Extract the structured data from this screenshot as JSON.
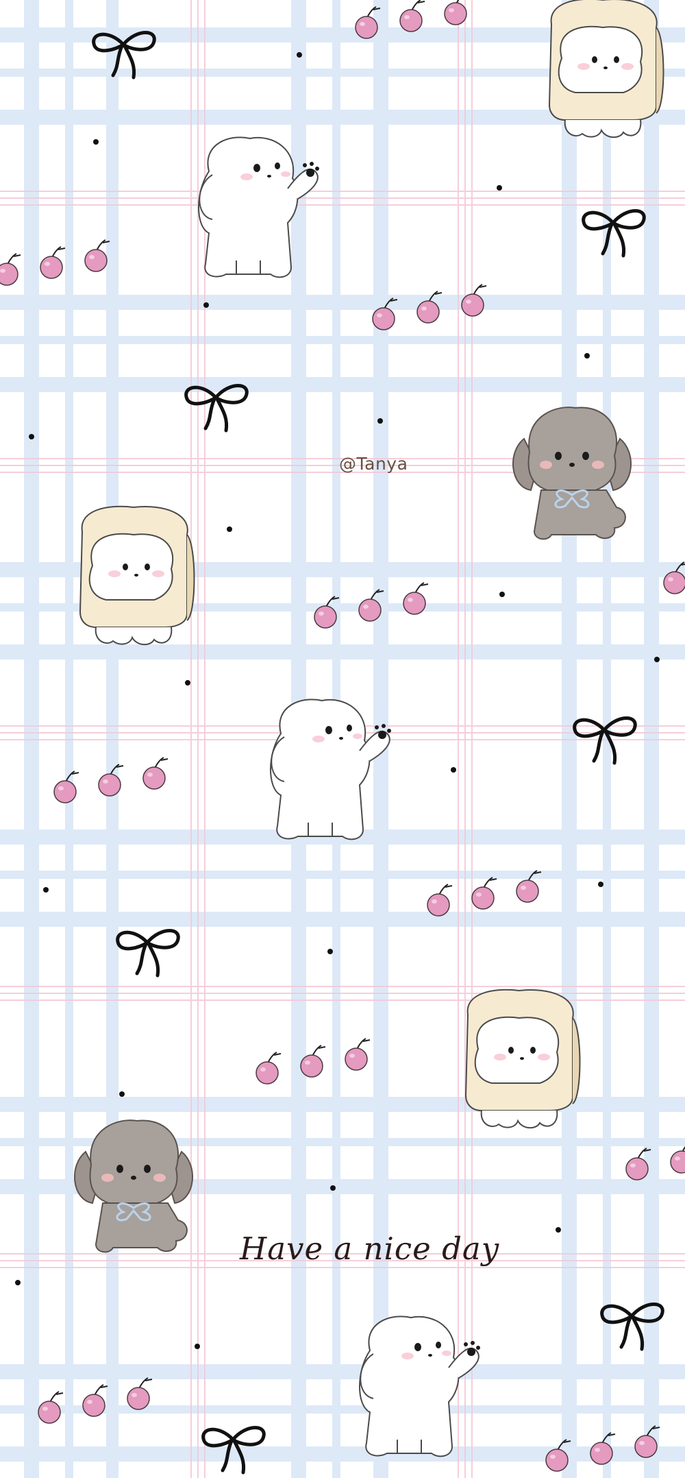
{
  "wallpaper": {
    "watermark": "@Tanya",
    "slogan": "Have a nice day",
    "colors": {
      "background": "#ffffff",
      "plaid_blue": "#cfe0f5",
      "plaid_pink": "#f4c9d6",
      "cherry": "#e59ac0",
      "ribbon": "#111111",
      "white_dog_outline": "#444444",
      "gray_dog": "#a39a95",
      "toast_crust": "#f4e7cc"
    },
    "icons": [
      "white-dog-waving",
      "white-dog-in-toast",
      "gray-poodle-with-bow",
      "cherry-trio",
      "black-ribbon-bow",
      "dot"
    ]
  }
}
